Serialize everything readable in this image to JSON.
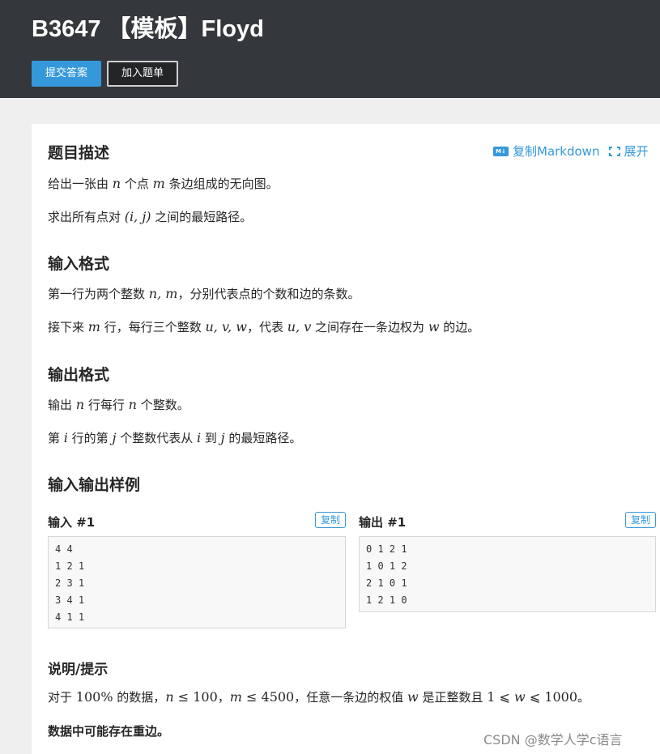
{
  "header": {
    "title": "B3647 【模板】Floyd",
    "submit_label": "提交答案",
    "add_label": "加入题单"
  },
  "toolbar": {
    "copy_markdown_label": "复制Markdown",
    "expand_label": "展开",
    "markdown_icon_text": "M↓"
  },
  "description": {
    "heading": "题目描述",
    "line1": {
      "t1": "给出一张由 ",
      "m1": "n",
      "t2": " 个点 ",
      "m2": "m",
      "t3": " 条边组成的无向图。"
    },
    "line2": {
      "t1": "求出所有点对 ",
      "m1": "(i, j)",
      "t2": " 之间的最短路径。"
    }
  },
  "input_format": {
    "heading": "输入格式",
    "line1": {
      "t1": "第一行为两个整数 ",
      "m1": "n, m",
      "t2": "，分别代表点的个数和边的条数。"
    },
    "line2": {
      "t1": "接下来 ",
      "m1": "m",
      "t2": " 行，每行三个整数 ",
      "m2": "u, v, w",
      "t3": "，代表 ",
      "m3": "u, v",
      "t4": " 之间存在一条边权为 ",
      "m4": "w",
      "t5": " 的边。"
    }
  },
  "output_format": {
    "heading": "输出格式",
    "line1": {
      "t1": "输出 ",
      "m1": "n",
      "t2": " 行每行 ",
      "m2": "n",
      "t3": " 个整数。"
    },
    "line2": {
      "t1": "第 ",
      "m1": "i",
      "t2": " 行的第 ",
      "m2": "j",
      "t3": " 个整数代表从 ",
      "m3": "i",
      "t4": " 到 ",
      "m4": "j",
      "t5": " 的最短路径。"
    }
  },
  "samples": {
    "heading": "输入输出样例",
    "input_title": "输入 #1",
    "output_title": "输出 #1",
    "copy_label": "复制",
    "input_lines": [
      "4 4",
      "1 2 1",
      "2 3 1",
      "3 4 1",
      "4 1 1"
    ],
    "output_lines": [
      "0 1 2 1",
      "1 0 1 2",
      "2 1 0 1",
      "1 2 1 0"
    ]
  },
  "hint": {
    "heading": "说明/提示",
    "line1": {
      "t1": "对于 ",
      "r1": "100%",
      "t2": " 的数据，",
      "m1": "n",
      "r2": " ≤ 100",
      "t3": "，",
      "m2": "m",
      "r3": " ≤ 4500",
      "t4": "，任意一条边的权值 ",
      "m3": "w",
      "t5": " 是正整数且 ",
      "r4": "1 ⩽ ",
      "m4": "w",
      "r5": " ⩽ 1000",
      "t6": "。"
    },
    "line2": "数据中可能存在重边。"
  },
  "watermark": "CSDN @数学人学c语言"
}
